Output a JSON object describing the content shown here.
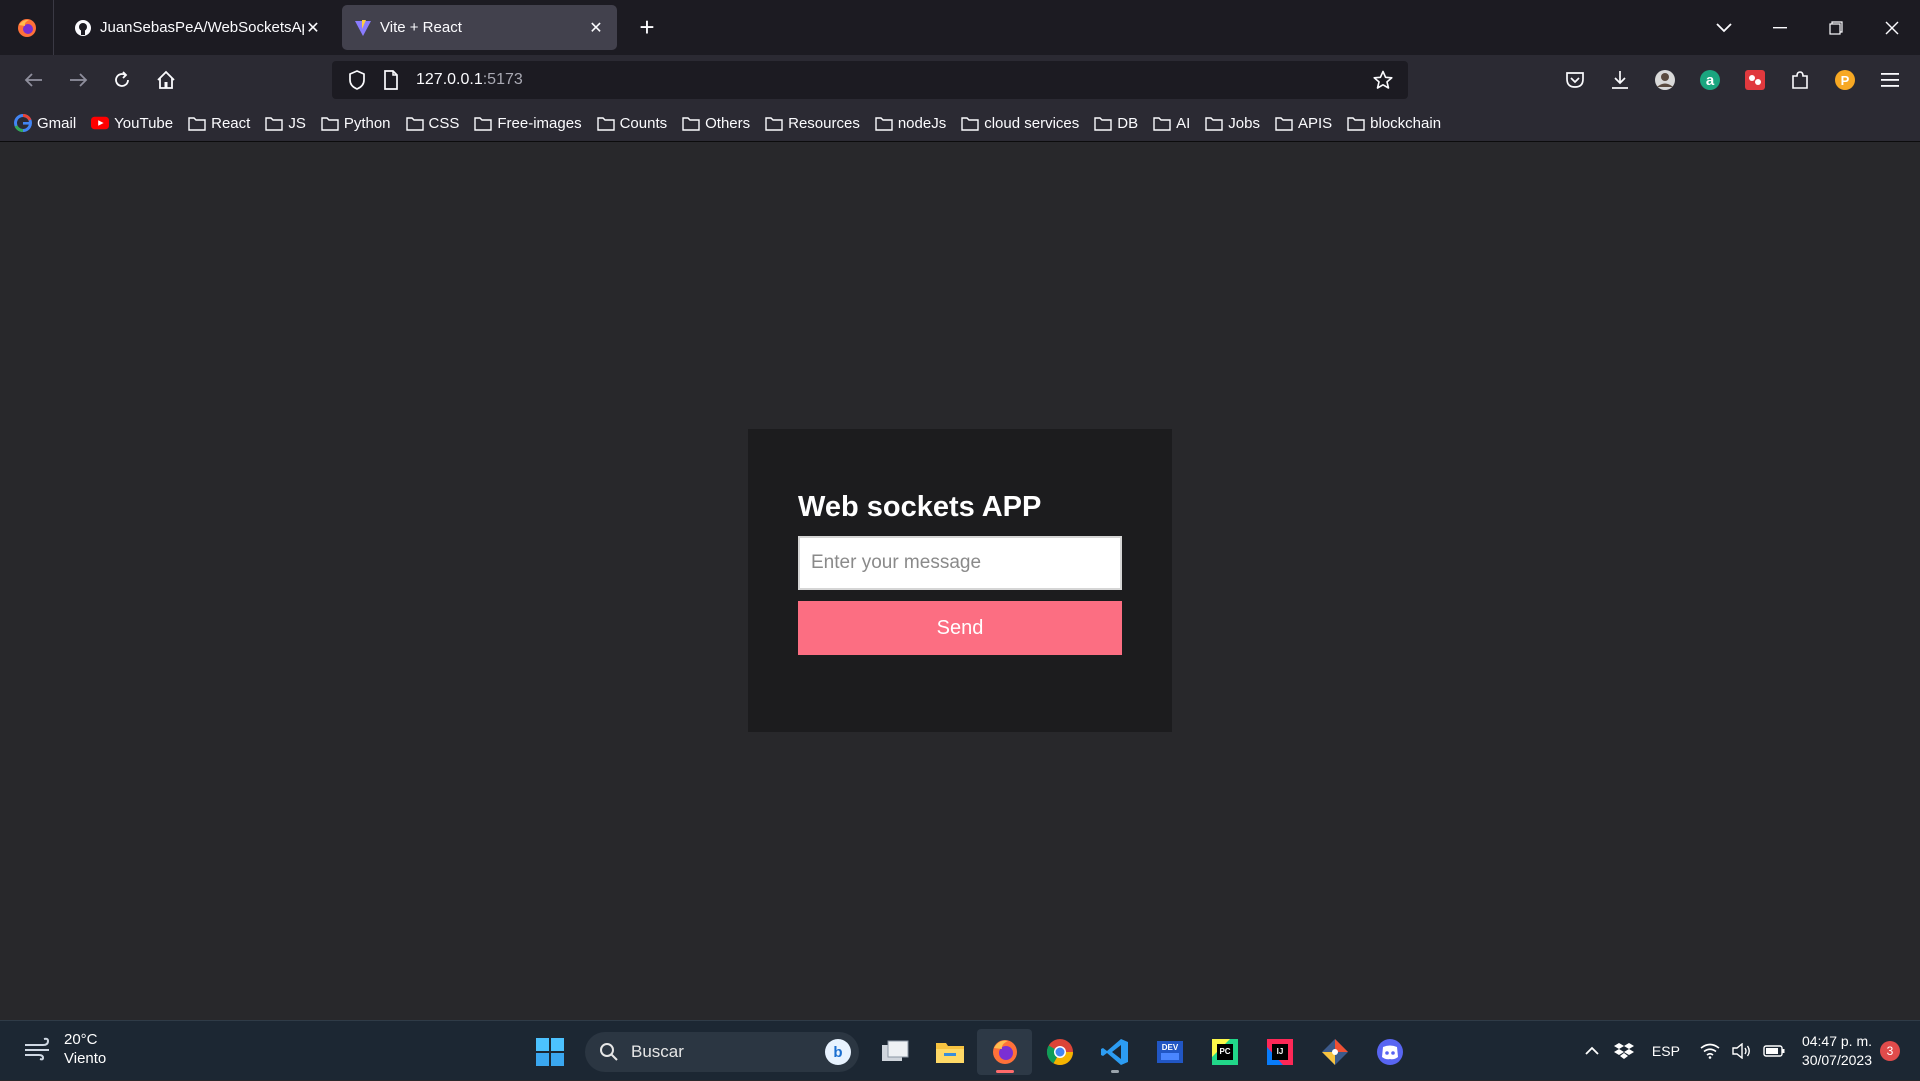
{
  "browser": {
    "tabs": [
      {
        "title": "JuanSebasPeA/WebSocketsApp",
        "icon": "github-icon",
        "active": false
      },
      {
        "title": "Vite + React",
        "icon": "vite-icon",
        "active": true
      }
    ],
    "url_host": "127.0.0.1",
    "url_port": ":5173",
    "bookmarks": [
      "Gmail",
      "YouTube",
      "React",
      "JS",
      "Python",
      "CSS",
      "Free-images",
      "Counts",
      "Others",
      "Resources",
      "nodeJs",
      "cloud services",
      "DB",
      "AI",
      "Jobs",
      "APIS",
      "blockchain"
    ]
  },
  "app": {
    "title": "Web sockets APP",
    "input_placeholder": "Enter your message",
    "send_label": "Send",
    "colors": {
      "card_bg": "#1c1c1e",
      "button_bg": "#fc6e82",
      "page_bg": "#28282b"
    }
  },
  "taskbar": {
    "weather_temp": "20°C",
    "weather_desc": "Viento",
    "search_label": "Buscar",
    "language": "ESP",
    "time": "04:47 p. m.",
    "date": "30/07/2023",
    "notifications": "3"
  }
}
